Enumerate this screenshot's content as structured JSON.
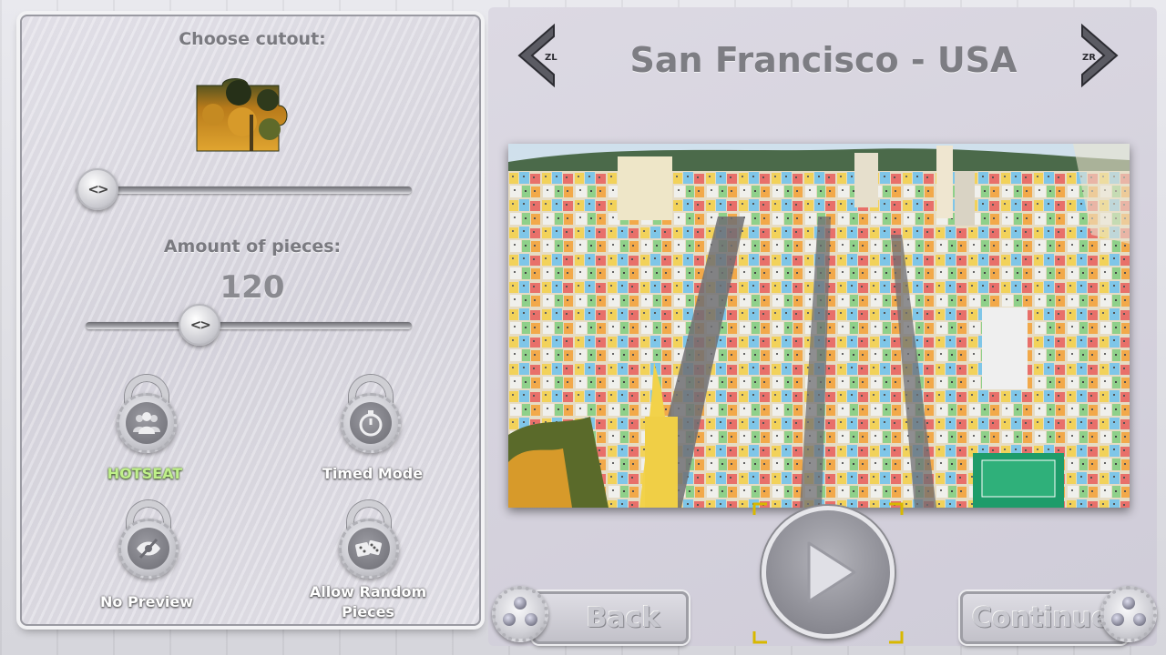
{
  "left_panel": {
    "cutout_title": "Choose cutout:",
    "pieces_title": "Amount of pieces:",
    "pieces_count": "120",
    "pieces_slider_level": 0.35,
    "options": [
      {
        "label": "HOTSEAT",
        "icon": "group-icon",
        "active": true
      },
      {
        "label": "Timed Mode",
        "icon": "stopwatch-icon",
        "active": false
      },
      {
        "label": "No Preview",
        "icon": "eye-off-icon",
        "active": false
      },
      {
        "label": "Allow Random Pieces",
        "icon": "dice-icon",
        "active": false
      }
    ]
  },
  "right_panel": {
    "title": "San Francisco - USA",
    "prev_label": "ZL",
    "next_label": "ZR",
    "back_label": "Back",
    "continue_label": "Continue"
  },
  "colors": {
    "active_option": "#bff08a",
    "frame_corners": "#d8b800",
    "label_gray": "#7a7a80"
  }
}
